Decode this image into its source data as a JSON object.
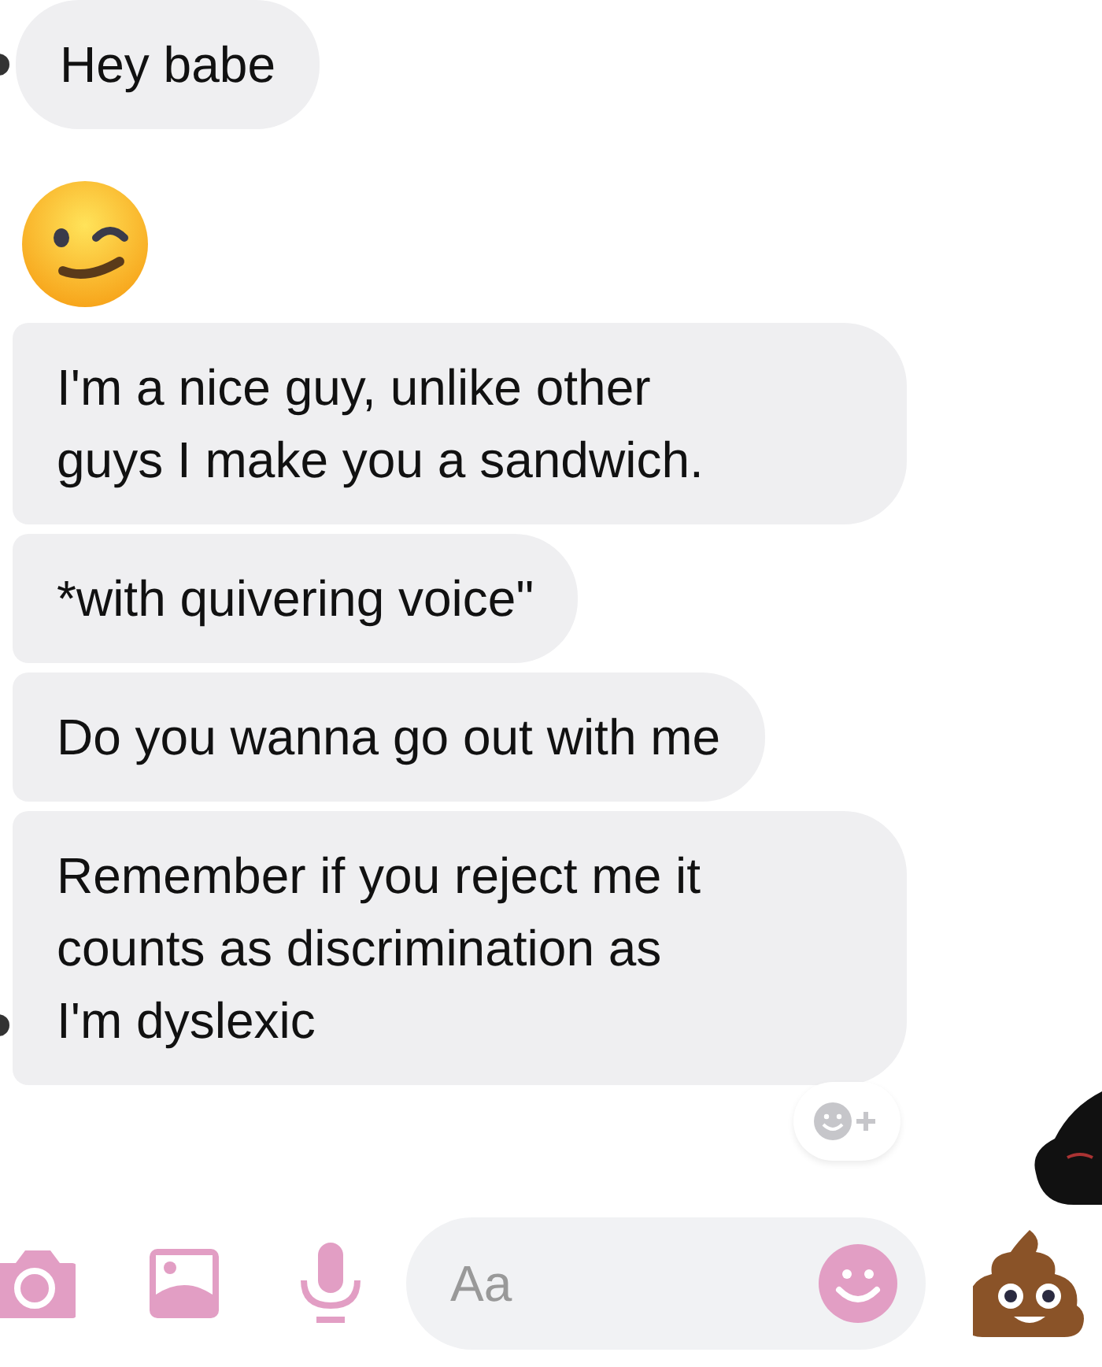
{
  "messages": [
    {
      "kind": "text",
      "lines": [
        "Hey babe"
      ]
    },
    {
      "kind": "emoji"
    },
    {
      "kind": "text",
      "lines": [
        "I'm a nice guy, unlike other",
        "guys I make you a sandwich."
      ]
    },
    {
      "kind": "text",
      "lines": [
        "*with quivering voice\""
      ]
    },
    {
      "kind": "text",
      "lines": [
        "Do you wanna go out with me"
      ]
    },
    {
      "kind": "text",
      "lines": [
        "Remember if you reject me it",
        "counts as discrimination as",
        "I'm dyslexic"
      ]
    }
  ],
  "composer": {
    "placeholder": "Aa"
  }
}
